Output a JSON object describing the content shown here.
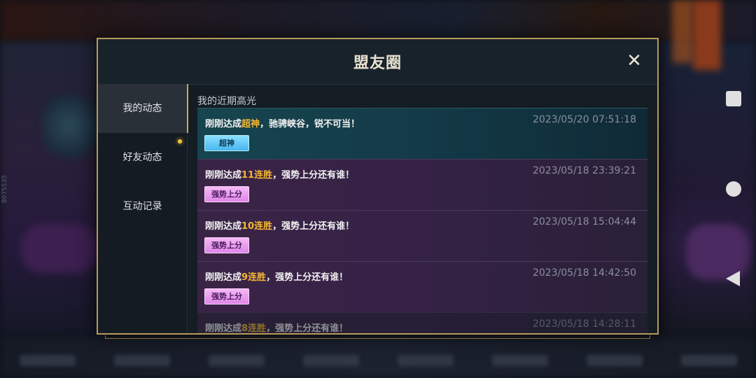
{
  "background": {
    "side_code": "8075535"
  },
  "dialog": {
    "title": "盟友圈",
    "close_icon": "close-icon",
    "tabs": [
      {
        "label": "我的动态",
        "active": true
      },
      {
        "label": "好友动态",
        "active": false,
        "has_notification": true
      },
      {
        "label": "互动记录",
        "active": false
      }
    ],
    "section_title": "我的近期高光",
    "entries": [
      {
        "prefix": "刚刚达成",
        "highlight": "超神",
        "suffix": "，驰骋峡谷，锐不可当！",
        "time": "2023/05/20 07:51:18",
        "badge": "超神",
        "badge_color": "#47b6ee"
      },
      {
        "prefix": "刚刚达成",
        "highlight": "11连胜",
        "suffix": "，强势上分还有谁！",
        "time": "2023/05/18 23:39:21",
        "badge": "强势上分",
        "badge_color": "#de86e8"
      },
      {
        "prefix": "刚刚达成",
        "highlight": "10连胜",
        "suffix": "，强势上分还有谁！",
        "time": "2023/05/18 15:04:44",
        "badge": "强势上分",
        "badge_color": "#de86e8"
      },
      {
        "prefix": "刚刚达成",
        "highlight": "9连胜",
        "suffix": "，强势上分还有谁！",
        "time": "2023/05/18 14:42:50",
        "badge": "强势上分",
        "badge_color": "#de86e8"
      },
      {
        "prefix": "刚刚达成",
        "highlight": "8连胜",
        "suffix": "，强势上分还有谁！",
        "time": "2023/05/18 14:28:11"
      }
    ]
  },
  "colors": {
    "accent_gold": "#c9a858",
    "highlight": "#f6b730",
    "notification_dot": "#f2c23a"
  },
  "system_nav": {
    "recent_icon": "square-icon",
    "home_icon": "circle-icon",
    "back_icon": "triangle-back-icon"
  }
}
